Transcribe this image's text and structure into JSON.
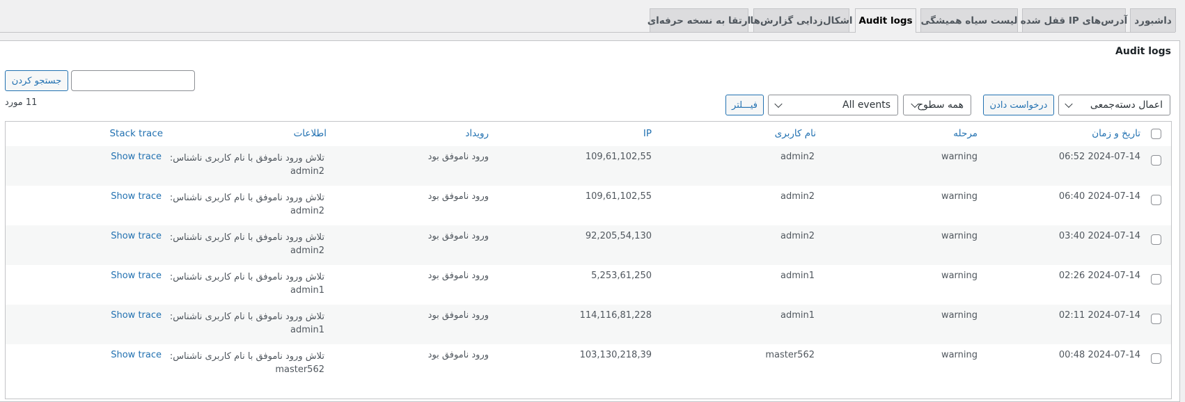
{
  "tabs": [
    {
      "label": "داشبورد",
      "active": false
    },
    {
      "label": "آدرس‌های IP قفل شده",
      "active": false
    },
    {
      "label": "لیست سیاه همیشگی",
      "active": false
    },
    {
      "label": "Audit logs",
      "active": true
    },
    {
      "label": "اشکال‌زدایی گزارش‌ها",
      "active": false
    },
    {
      "label": "ارتقا به نسخه حرفه‌ای",
      "active": false
    }
  ],
  "page": {
    "title": "Audit logs",
    "search": {
      "value": "",
      "placeholder": "",
      "button_label": "جستجو کردن"
    },
    "items_count": "11 مورد",
    "bulk_actions": {
      "selected": "اعمال دسته‌جمعی",
      "apply_label": "درخواست دادن"
    },
    "level_filter": {
      "selected": "همه سطوح"
    },
    "event_filter": {
      "selected": "All events"
    },
    "filter_button_label": "فیـــلتر"
  },
  "table": {
    "columns": {
      "datetime": "تاریخ و زمان",
      "level": "مرحله",
      "username": "نام کاربری",
      "ip": "IP",
      "event": "رویداد",
      "info": "اطلاعات",
      "stack_trace": "Stack trace"
    },
    "rows": [
      {
        "datetime": "06:52 2024-07-14",
        "level": "warning",
        "username": "admin2",
        "ip": "109,61,102,55",
        "event": "ورود ناموفق بود",
        "info_line1": "تلاش ورود ناموفق با نام کاربری ناشناس:",
        "info_line2": "admin2",
        "trace": "Show trace"
      },
      {
        "datetime": "06:40 2024-07-14",
        "level": "warning",
        "username": "admin2",
        "ip": "109,61,102,55",
        "event": "ورود ناموفق بود",
        "info_line1": "تلاش ورود ناموفق با نام کاربری ناشناس:",
        "info_line2": "admin2",
        "trace": "Show trace"
      },
      {
        "datetime": "03:40 2024-07-14",
        "level": "warning",
        "username": "admin2",
        "ip": "92,205,54,130",
        "event": "ورود ناموفق بود",
        "info_line1": "تلاش ورود ناموفق با نام کاربری ناشناس:",
        "info_line2": "admin2",
        "trace": "Show trace"
      },
      {
        "datetime": "02:26 2024-07-14",
        "level": "warning",
        "username": "admin1",
        "ip": "5,253,61,250",
        "event": "ورود ناموفق بود",
        "info_line1": "تلاش ورود ناموفق با نام کاربری ناشناس:",
        "info_line2": "admin1",
        "trace": "Show trace"
      },
      {
        "datetime": "02:11 2024-07-14",
        "level": "warning",
        "username": "admin1",
        "ip": "114,116,81,228",
        "event": "ورود ناموفق بود",
        "info_line1": "تلاش ورود ناموفق با نام کاربری ناشناس:",
        "info_line2": "admin1",
        "trace": "Show trace"
      },
      {
        "datetime": "00:48 2024-07-14",
        "level": "warning",
        "username": "master562",
        "ip": "103,130,218,39",
        "event": "ورود ناموفق بود",
        "info_line1": "تلاش ورود ناموفق با نام کاربری ناشناس:",
        "info_line2": "master562",
        "trace": "Show trace"
      }
    ]
  },
  "colors": {
    "accent": "#2271b1",
    "background": "#f0f0f1",
    "stripe": "#f6f7f7",
    "border": "#c3c4c7"
  }
}
